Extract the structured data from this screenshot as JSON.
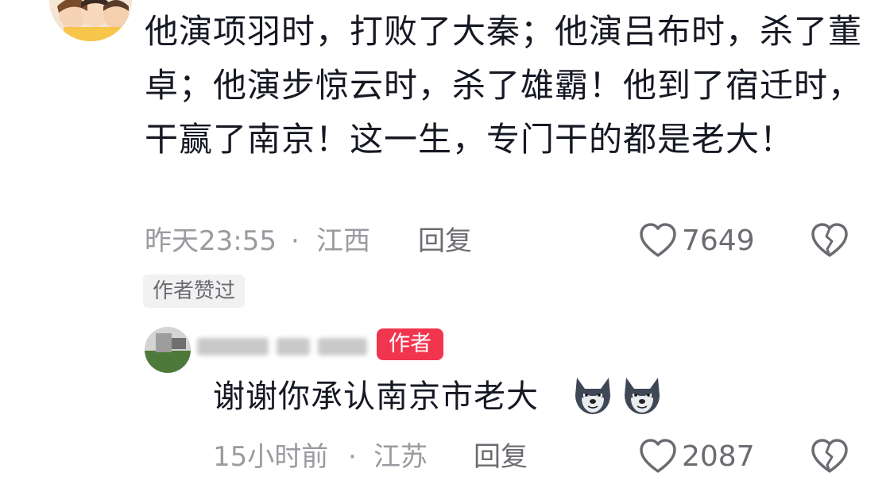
{
  "comment": {
    "text": "他演项羽时，打败了大秦；他演吕布时，杀了董卓；他演步惊云时，杀了雄霸！他到了宿迁时，干赢了南京！这一生，专门干的都是老大！",
    "time": "昨天23:55",
    "separator": "·",
    "location": "江西",
    "reply_label": "回复",
    "likes": "7649",
    "liked_by_author_badge": "作者赞过"
  },
  "reply": {
    "author_badge": "作者",
    "text": "谢谢你承认南京市老大",
    "time": "15小时前",
    "separator": "·",
    "location": "江苏",
    "reply_label": "回复",
    "likes": "2087"
  },
  "icons": {
    "like": "heart-outline-icon",
    "dislike": "broken-heart-icon",
    "emoji": "wolf-emoji"
  },
  "colors": {
    "text": "#161823",
    "meta": "#9a9ba0",
    "author_badge": "#f2354f",
    "badge_bg": "#f1f1f2"
  }
}
